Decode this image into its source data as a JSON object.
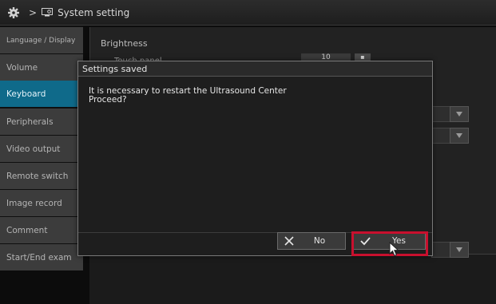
{
  "titlebar": {
    "icon": "gear-icon",
    "separator": ">",
    "folder_icon": "monitor-settings-icon",
    "title": "System setting"
  },
  "sidebar": {
    "items": [
      {
        "label": "Language / Display",
        "active": false
      },
      {
        "label": "Volume",
        "active": false
      },
      {
        "label": "Keyboard",
        "active": true
      },
      {
        "label": "Peripherals",
        "active": false
      },
      {
        "label": "Video output",
        "active": false
      },
      {
        "label": "Remote switch",
        "active": false
      },
      {
        "label": "Image record",
        "active": false
      },
      {
        "label": "Comment",
        "active": false
      },
      {
        "label": "Start/End exam",
        "active": false
      }
    ]
  },
  "content": {
    "brightness_label": "Brightness",
    "touch_panel_label": "Touch panel",
    "touch_panel_value": "10"
  },
  "dialog": {
    "title": "Settings saved",
    "message_line1": "It is necessary to restart the Ultrasound Center",
    "message_line2": "Proceed?",
    "no_label": "No",
    "yes_label": "Yes",
    "no_icon": "close-icon",
    "yes_icon": "check-icon"
  },
  "colors": {
    "active_item": "#0f6a8a",
    "highlight": "#c8102e"
  }
}
